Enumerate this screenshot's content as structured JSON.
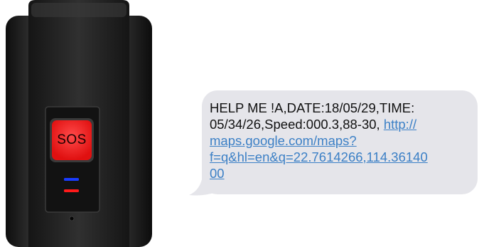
{
  "device": {
    "sos_button_label": "SOS",
    "colors": {
      "body": "#1b1b1b",
      "button": "#ff2a2a",
      "led_blue": "#1a3cff",
      "led_red": "#ff1a1a"
    }
  },
  "message": {
    "text": "HELP ME !A,DATE:18/05/29,TIME:\n05/34/26,Speed:000.3,88-30, ",
    "link": "http://\nmaps.google.com/maps?\nf=q&hl=en&q=22.7614266,114.36140\n00",
    "colors": {
      "bubble": "#e5e5ea",
      "text": "#111111",
      "link": "#3c80c6"
    }
  }
}
